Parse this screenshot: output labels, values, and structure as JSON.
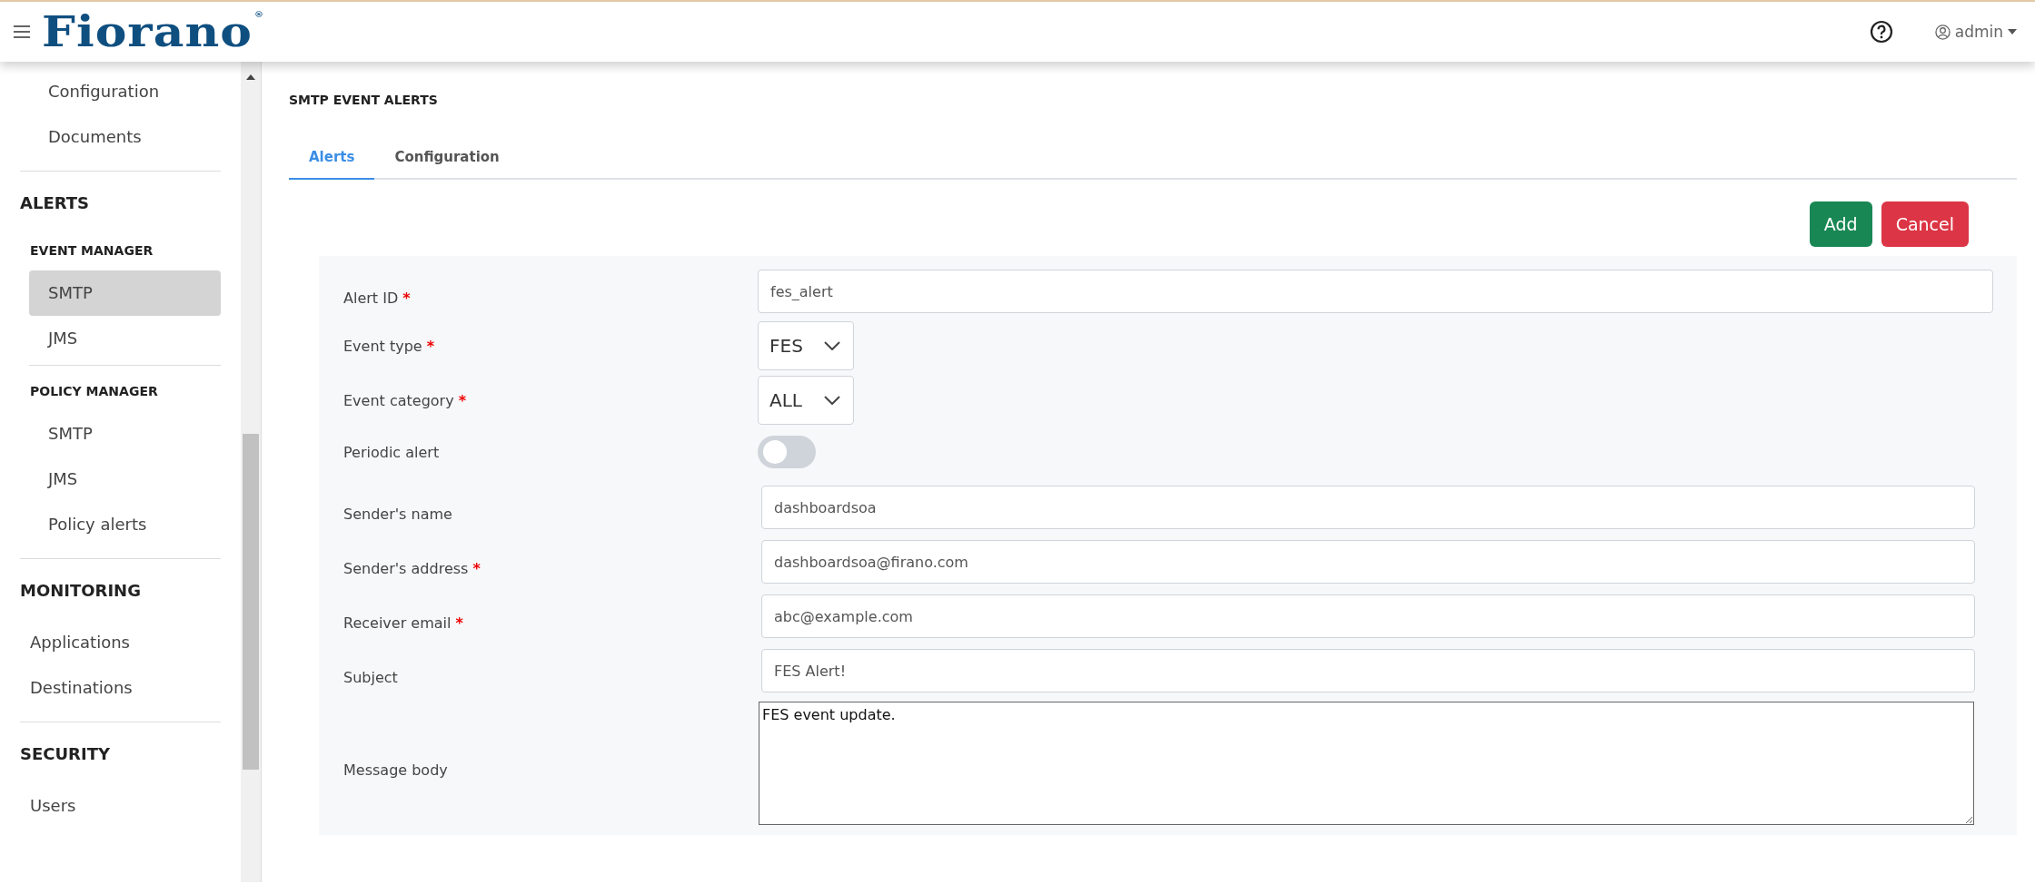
{
  "header": {
    "logo": {
      "text": "Fiorano",
      "mark": "®"
    },
    "user": "admin"
  },
  "sidebar": {
    "items": [
      {
        "label": "Configuration",
        "selected": false
      },
      {
        "label": "Documents",
        "selected": false
      }
    ],
    "sections": [
      {
        "title": "ALERTS",
        "groups": [
          {
            "title": "EVENT MANAGER",
            "items": [
              {
                "label": "SMTP",
                "selected": true
              },
              {
                "label": "JMS",
                "selected": false
              }
            ]
          },
          {
            "title": "POLICY MANAGER",
            "items": [
              {
                "label": "SMTP",
                "selected": false
              },
              {
                "label": "JMS",
                "selected": false
              },
              {
                "label": "Policy alerts",
                "selected": false
              }
            ]
          }
        ]
      },
      {
        "title": "MONITORING",
        "groups": [
          {
            "items": [
              {
                "label": "Applications",
                "selected": false
              },
              {
                "label": "Destinations",
                "selected": false
              }
            ]
          }
        ]
      },
      {
        "title": "SECURITY",
        "groups": [
          {
            "items": [
              {
                "label": "Users",
                "selected": false
              }
            ]
          }
        ]
      }
    ]
  },
  "page": {
    "title": "SMTP EVENT ALERTS",
    "tabs": [
      {
        "label": "Alerts",
        "selected": true
      },
      {
        "label": "Configuration",
        "selected": false
      }
    ],
    "buttons": [
      {
        "label": "Add",
        "kind": "primary"
      },
      {
        "label": "Cancel",
        "kind": "danger"
      }
    ],
    "form": [
      {
        "label": "Alert ID",
        "required_mark": "*",
        "kind": "text",
        "value": "fes_alert",
        "wide": true
      },
      {
        "label": "Event type",
        "required_mark": "*",
        "kind": "select",
        "value": "FES"
      },
      {
        "label": "Event category",
        "required_mark": "*",
        "kind": "select",
        "value": "ALL"
      },
      {
        "label": "Periodic alert",
        "kind": "toggle",
        "on": false
      },
      {
        "label": "Sender's name",
        "kind": "text",
        "value": "dashboardsoa"
      },
      {
        "label": "Sender's address",
        "required_mark": "*",
        "kind": "text",
        "value": "dashboardsoa@firano.com"
      },
      {
        "label": "Receiver email",
        "required_mark": "*",
        "kind": "text",
        "value": "abc@example.com"
      },
      {
        "label": "Subject",
        "kind": "text",
        "value": "FES Alert!"
      },
      {
        "label": "Message body",
        "kind": "textarea",
        "value": "FES event update."
      }
    ]
  }
}
